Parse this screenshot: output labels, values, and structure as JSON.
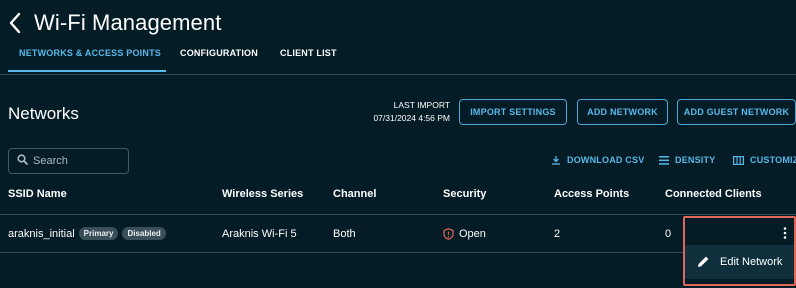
{
  "header": {
    "title": "Wi-Fi Management",
    "tabs": [
      {
        "label": "NETWORKS & ACCESS POINTS",
        "active": true
      },
      {
        "label": "CONFIGURATION",
        "active": false
      },
      {
        "label": "CLIENT LIST",
        "active": false
      }
    ]
  },
  "networks": {
    "title": "Networks",
    "last_import_label": "LAST IMPORT",
    "last_import_value": "07/31/2024 4:56 PM",
    "buttons": {
      "import_settings": "IMPORT SETTINGS",
      "add_network": "ADD NETWORK",
      "add_guest_network": "ADD GUEST NETWORK"
    },
    "search_placeholder": "Search",
    "toolbar": {
      "download_csv": "DOWNLOAD CSV",
      "density": "DENSITY",
      "customize": "CUSTOMIZ"
    }
  },
  "table": {
    "columns": [
      "SSID Name",
      "Wireless Series",
      "Channel",
      "Security",
      "Access Points",
      "Connected Clients"
    ],
    "rows": [
      {
        "ssid": "araknis_initial",
        "badges": [
          "Primary",
          "Disabled"
        ],
        "series": "Araknis Wi-Fi 5",
        "channel": "Both",
        "security": "Open",
        "access_points": "2",
        "connected_clients": "0"
      }
    ]
  },
  "row_menu": {
    "items": [
      {
        "label": "Edit Network",
        "icon": "pencil-icon"
      }
    ]
  },
  "colors": {
    "background": "#041c26",
    "accent": "#59b8e8",
    "warning": "#e0675a",
    "badge": "#3a4f58"
  }
}
